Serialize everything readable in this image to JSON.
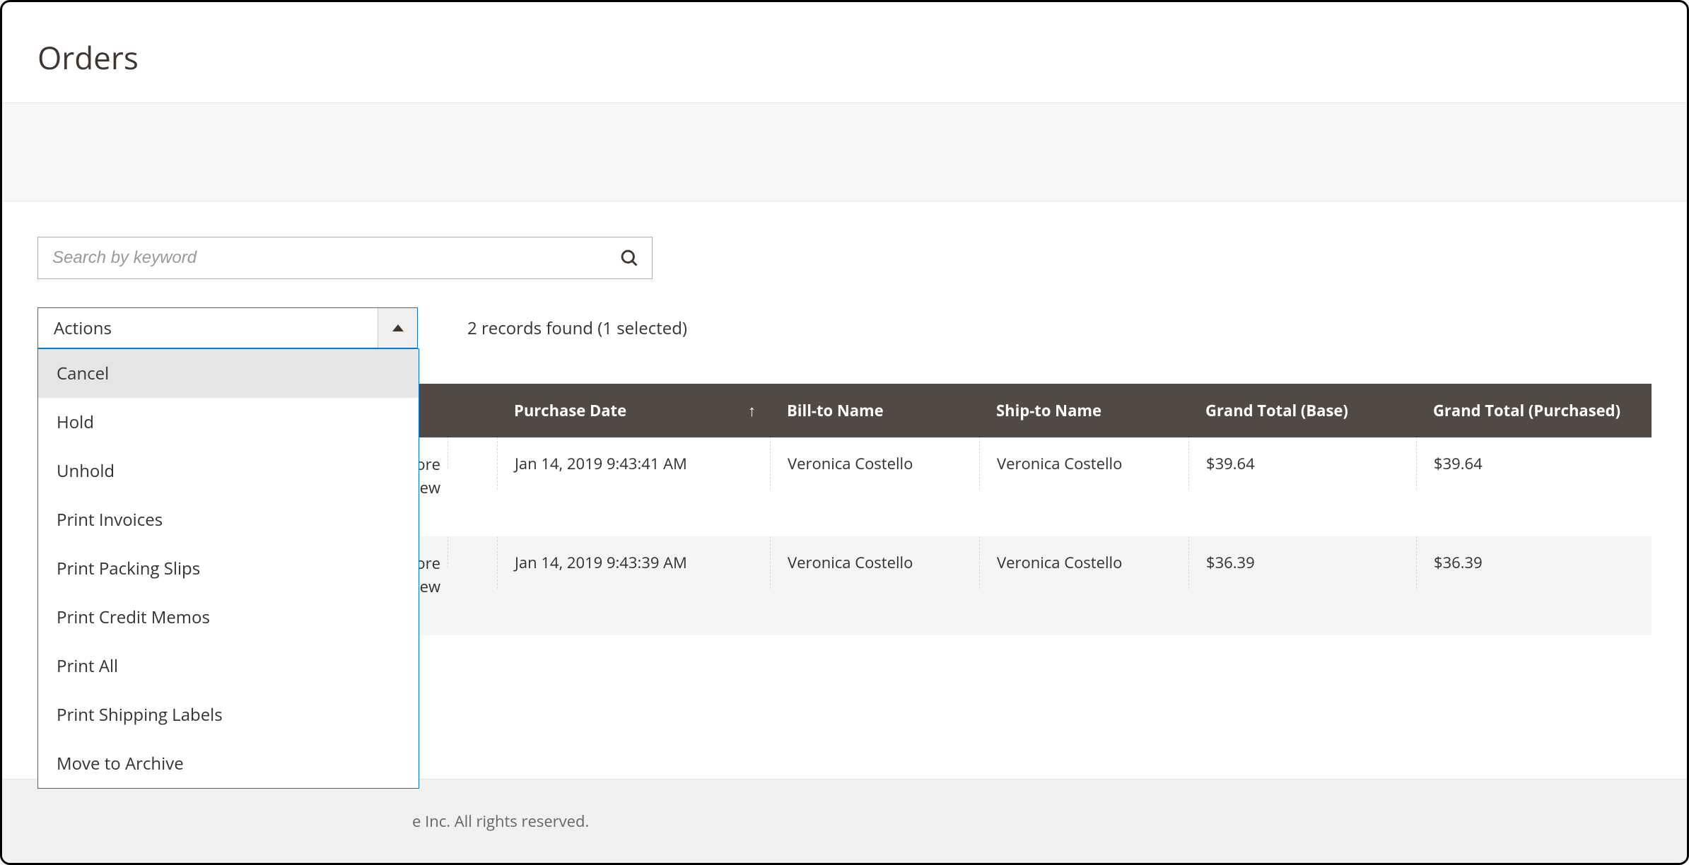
{
  "page": {
    "title": "Orders"
  },
  "search": {
    "placeholder": "Search by keyword"
  },
  "actions": {
    "label": "Actions",
    "items": [
      "Cancel",
      "Hold",
      "Unhold",
      "Print Invoices",
      "Print Packing Slips",
      "Print Credit Memos",
      "Print All",
      "Print Shipping Labels",
      "Move to Archive"
    ]
  },
  "summary": {
    "records_found": "2 records found (1 selected)"
  },
  "columns": {
    "purchase_date": "Purchase Date",
    "bill_to": "Bill-to Name",
    "ship_to": "Ship-to Name",
    "grand_base": "Grand Total (Base)",
    "grand_purchased": "Grand Total (Purchased)"
  },
  "rows": [
    {
      "store_line1": "ore",
      "store_line2": "View",
      "purchase_date": "Jan 14, 2019 9:43:41 AM",
      "bill_to": "Veronica Costello",
      "ship_to": "Veronica Costello",
      "grand_base": "$39.64",
      "grand_purchased": "$39.64"
    },
    {
      "store_line1": "ore",
      "store_line2": "View",
      "purchase_date": "Jan 14, 2019 9:43:39 AM",
      "bill_to": "Veronica Costello",
      "ship_to": "Veronica Costello",
      "grand_base": "$36.39",
      "grand_purchased": "$36.39"
    }
  ],
  "footer": {
    "text": "e Inc. All rights reserved."
  }
}
